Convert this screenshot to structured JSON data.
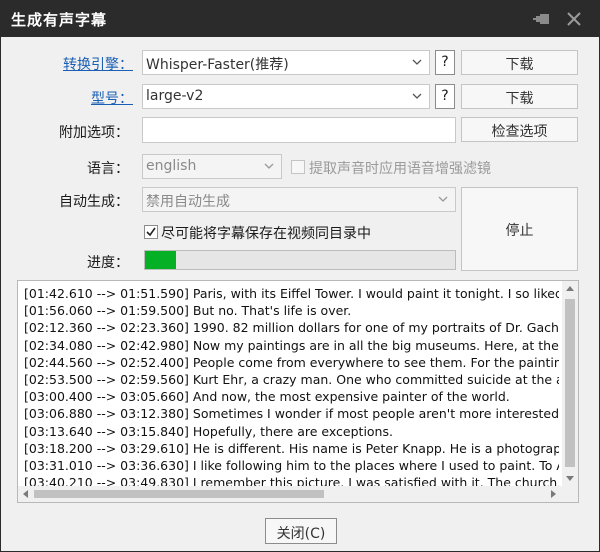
{
  "window": {
    "title": "生成有声字幕"
  },
  "engine": {
    "label": "转换引擎：",
    "value": "Whisper-Faster(推荐)",
    "help": "?",
    "download": "下载"
  },
  "model": {
    "label": "型号：",
    "value": "large-v2",
    "help": "?",
    "download": "下载"
  },
  "extra": {
    "label": "附加选项：",
    "value": "",
    "check_button": "检查选项"
  },
  "language": {
    "label": "语言：",
    "value": "english",
    "enhance_label": "提取声音时应用语音增强滤镜",
    "enhance_checked": false
  },
  "auto": {
    "label": "自动生成：",
    "value": "禁用自动生成"
  },
  "save_same_dir": {
    "label": "尽可能将字幕保存在视频同目录中",
    "checked": true
  },
  "stop_button": "停止",
  "progress": {
    "label": "进度：",
    "value": 0.1,
    "color": "#06b025"
  },
  "log_lines": [
    "[01:42.610 --> 01:51.590] Paris, with its Eiffel Tower. I would paint it tonight. I so liked paint",
    "[01:56.060 --> 01:59.500] But no. That's life is over.",
    "[02:12.360 --> 02:23.360] 1990. 82 million dollars for one of my portraits of Dr. Gachet. Yet",
    "[02:34.080 --> 02:42.980] Now my paintings are in all the big museums. Here, at the Orsay",
    "[02:44.560 --> 02:52.400] People come from everywhere to see them. For the paintings an",
    "[02:53.500 --> 02:59.560] Kurt Ehr, a crazy man. One who committed suicide at the age of",
    "[03:00.400 --> 03:05.660] And now, the most expensive painter of the world.",
    "[03:06.880 --> 03:12.380] Sometimes I wonder if most people aren't more interested in all",
    "[03:13.640 --> 03:15.840] Hopefully, there are exceptions.",
    "[03:18.200 --> 03:29.610] He is different. His name is Peter Knapp. He is a photographer ar",
    "[03:31.010 --> 03:36.630] I like following him to the places where I used to paint. To Auver",
    "[03:40.210 --> 03:49.830] I remember this picture. I was satisfied with it. The church, practi"
  ],
  "close_button": "关闭(C)"
}
